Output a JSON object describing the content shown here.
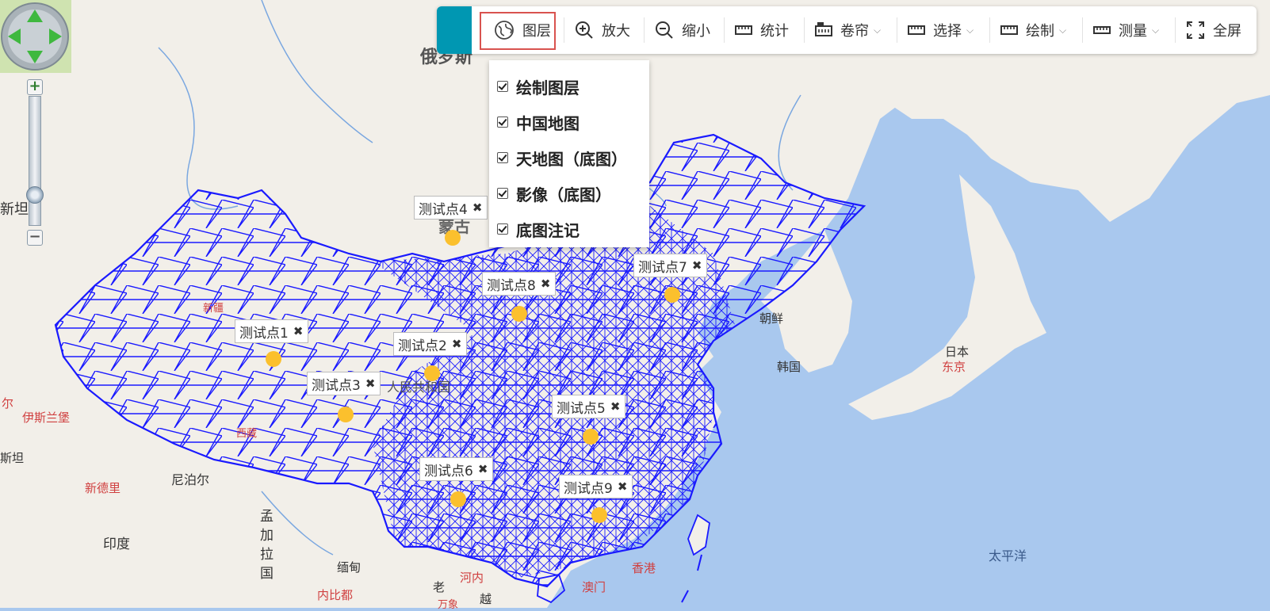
{
  "toolbar": {
    "items": [
      {
        "label": "图层",
        "icon": "globe-icon"
      },
      {
        "label": "放大",
        "icon": "zoom-in-icon"
      },
      {
        "label": "缩小",
        "icon": "zoom-out-icon"
      },
      {
        "label": "统计",
        "icon": "ruler-icon"
      },
      {
        "label": "卷帘",
        "icon": "swipe-icon"
      },
      {
        "label": "选择",
        "icon": "ruler-icon"
      },
      {
        "label": "绘制",
        "icon": "ruler-icon"
      },
      {
        "label": "测量",
        "icon": "measure-icon"
      },
      {
        "label": "全屏",
        "icon": "fullscreen-icon"
      }
    ],
    "accent_color": "#0097b2",
    "highlight_color": "#d9534f"
  },
  "layers": [
    {
      "label": "绘制图层",
      "checked": true
    },
    {
      "label": "中国地图",
      "checked": true
    },
    {
      "label": "天地图（底图）",
      "checked": true
    },
    {
      "label": "影像（底图）",
      "checked": true
    },
    {
      "label": "底图注记",
      "checked": true
    }
  ],
  "test_points": [
    {
      "label": "测试点1"
    },
    {
      "label": "测试点2"
    },
    {
      "label": "测试点3"
    },
    {
      "label": "测试点4"
    },
    {
      "label": "测试点5"
    },
    {
      "label": "测试点6"
    },
    {
      "label": "测试点7"
    },
    {
      "label": "测试点8"
    },
    {
      "label": "测试点9"
    }
  ],
  "close_glyph": "✖",
  "places": {
    "russia": "俄罗斯",
    "mongolia": "蒙古",
    "xinjiang": "新疆",
    "xizang": "西藏",
    "peoples_rep": "人民共和国",
    "korea_north": "朝鲜",
    "korea_south": "韩国",
    "japan": "日本",
    "tokyo": "东京",
    "nepal": "尼泊尔",
    "new_delhi": "新德里",
    "india": "印度",
    "bangladesh": "孟加拉国",
    "myanmar": "缅甸",
    "laos": "老",
    "hanoi": "河内",
    "vietnam": "越",
    "vientiane": "万象",
    "kolkata": "内比都",
    "hongkong": "香港",
    "macau": "澳门",
    "pacific": "太平洋",
    "islamabad": "伊斯兰堡",
    "xinjiang_w": "新疆",
    "stan_w": "斯坦",
    "er": "尔",
    "xin": "新坦"
  },
  "colors": {
    "sea": "#a9c8ee",
    "land": "#f2efe9",
    "border": "#1a1aff",
    "dot": "#fbc02d",
    "capital": "#e03030"
  }
}
